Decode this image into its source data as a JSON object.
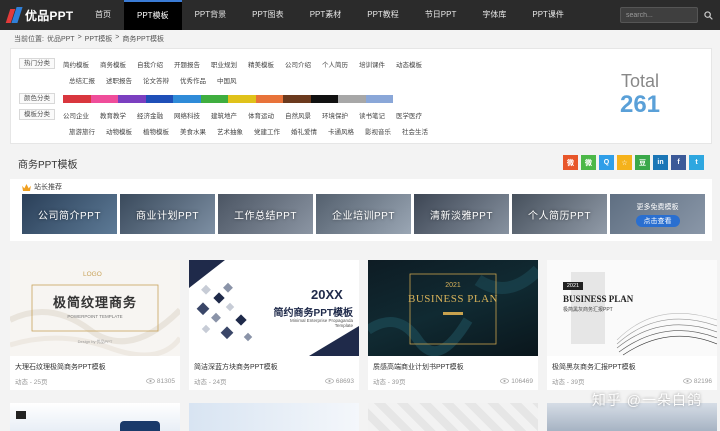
{
  "nav": {
    "logo_text": "优品PPT",
    "items": [
      "首页",
      "PPT模板",
      "PPT背景",
      "PPT图表",
      "PPT素材",
      "PPT教程",
      "节日PPT",
      "字体库",
      "PPT课件"
    ],
    "active_index": 1,
    "search_placeholder": "search..."
  },
  "breadcrumb": {
    "prefix": "当前位置:",
    "items": [
      "优品PPT",
      "PPT模板",
      "商务PPT模板"
    ],
    "separator": ">"
  },
  "filters": {
    "hot": {
      "label": "热门分类",
      "row1": [
        "简约模板",
        "商务模板",
        "自我介绍",
        "开题报告",
        "职业规划",
        "精美模板",
        "公司介绍",
        "个人简历",
        "培训课件",
        "动态模板"
      ],
      "row2": [
        "总结汇报",
        "述职报告",
        "论文答辩",
        "优秀作品",
        "中国风"
      ]
    },
    "color": {
      "label": "颜色分类",
      "swatches": [
        "#d9363e",
        "#ef4d9a",
        "#7b3fc0",
        "#1f4fb8",
        "#2f8bd8",
        "#3fae3f",
        "#e0c21a",
        "#e8733a",
        "#6b3a1e",
        "#111111",
        "#a7a7a7",
        "#8aa7d8"
      ]
    },
    "template": {
      "label": "模板分类",
      "row1": [
        "公司企业",
        "教育教学",
        "经济金融",
        "网络科技",
        "建筑地产",
        "体育运动",
        "自然风景",
        "环境保护",
        "读书笔记",
        "医学医疗"
      ],
      "row2": [
        "旅游旅行",
        "动物模板",
        "植物模板",
        "美食水果",
        "艺术抽象",
        "党建工作",
        "婚礼爱情",
        "卡通风格",
        "影视音乐",
        "社会生活"
      ]
    }
  },
  "total": {
    "label": "Total",
    "count": "261"
  },
  "section_title": "商务PPT模板",
  "shares": [
    {
      "icon": "weibo-icon",
      "glyph": "微",
      "color": "#e8562a"
    },
    {
      "icon": "wechat-icon",
      "glyph": "微",
      "color": "#4cb848"
    },
    {
      "icon": "qq-icon",
      "glyph": "Q",
      "color": "#2f9ee8"
    },
    {
      "icon": "qzone-icon",
      "glyph": "☆",
      "color": "#f5b21b"
    },
    {
      "icon": "douban-icon",
      "glyph": "豆",
      "color": "#3aa84a"
    },
    {
      "icon": "linkedin-icon",
      "glyph": "in",
      "color": "#1b76b6"
    },
    {
      "icon": "facebook-icon",
      "glyph": "f",
      "color": "#3b5998"
    },
    {
      "icon": "twitter-icon",
      "glyph": "t",
      "color": "#2ea7e0"
    }
  ],
  "recommend": {
    "title": "站长推荐",
    "items": [
      "公司简介PPT",
      "商业计划PPT",
      "工作总结PPT",
      "企业培训PPT",
      "清新淡雅PPT",
      "个人简历PPT"
    ],
    "more_text": "更多免费模板",
    "more_button": "点击查看"
  },
  "cards": [
    {
      "title": "大理石纹理极简商务PPT模板",
      "meta": "动态 - 25页",
      "views": "81305",
      "thumb_text": "极简纹理商务",
      "thumb_logo": "LOGO",
      "thumb_sub": "POWERPOINT TEMPLATE",
      "thumb_design": "Design by 优品PPT"
    },
    {
      "title": "简洁深蓝方块商务PPT模板",
      "meta": "动态 - 24页",
      "views": "68693",
      "thumb_year": "20XX",
      "thumb_text": "简约商务PPT模板",
      "thumb_sub": "Minimal Enterprise Propaganda Template"
    },
    {
      "title": "质感高端商业计划书PPT模板",
      "meta": "动态 - 39页",
      "views": "106469",
      "thumb_year": "2021",
      "thumb_text": "BUSINESS PLAN"
    },
    {
      "title": "极简黑灰商务汇报PPT模板",
      "meta": "动态 - 39页",
      "views": "82196",
      "thumb_year": "2021",
      "thumb_text": "BUSINESS PLAN",
      "thumb_sub": "极简黑灰商务汇报PPT"
    }
  ],
  "watermark": "知乎 @一朵白鸽"
}
